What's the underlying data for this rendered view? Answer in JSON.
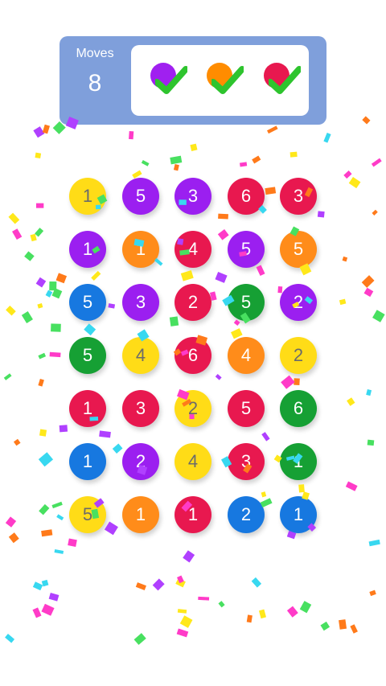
{
  "hud": {
    "moves_label": "Moves",
    "moves_value": "8",
    "goals": [
      {
        "color_name": "purple",
        "color": "#a020f0",
        "icon": "check-icon",
        "completed": true
      },
      {
        "color_name": "orange",
        "color": "#ff8c00",
        "icon": "check-icon",
        "completed": true
      },
      {
        "color_name": "red",
        "color": "#e8184f",
        "icon": "check-icon",
        "completed": true
      }
    ]
  },
  "colors": {
    "yellow": "#ffdc17",
    "purple": "#9b1ff0",
    "red": "#e8184f",
    "orange": "#ff8c1a",
    "blue": "#1778e0",
    "green": "#16a034",
    "hud_bg": "#7f9fdb",
    "check": "#2ec42e"
  },
  "grid": [
    [
      {
        "c": "yellow",
        "n": "1"
      },
      {
        "c": "purple",
        "n": "5"
      },
      {
        "c": "purple",
        "n": "3"
      },
      {
        "c": "red",
        "n": "6"
      },
      {
        "c": "red",
        "n": "3"
      }
    ],
    [
      {
        "c": "purple",
        "n": "1"
      },
      {
        "c": "orange",
        "n": "1"
      },
      {
        "c": "red",
        "n": "4"
      },
      {
        "c": "purple",
        "n": "5"
      },
      {
        "c": "orange",
        "n": "5"
      }
    ],
    [
      {
        "c": "blue",
        "n": "5"
      },
      {
        "c": "purple",
        "n": "3"
      },
      {
        "c": "red",
        "n": "2"
      },
      {
        "c": "green",
        "n": "5"
      },
      {
        "c": "purple",
        "n": "2"
      }
    ],
    [
      {
        "c": "green",
        "n": "5"
      },
      {
        "c": "yellow",
        "n": "4"
      },
      {
        "c": "red",
        "n": "6"
      },
      {
        "c": "orange",
        "n": "4"
      },
      {
        "c": "yellow",
        "n": "2"
      }
    ],
    [
      {
        "c": "red",
        "n": "1"
      },
      {
        "c": "red",
        "n": "3"
      },
      {
        "c": "yellow",
        "n": "2"
      },
      {
        "c": "red",
        "n": "5"
      },
      {
        "c": "green",
        "n": "6"
      }
    ],
    [
      {
        "c": "blue",
        "n": "1"
      },
      {
        "c": "purple",
        "n": "2"
      },
      {
        "c": "yellow",
        "n": "4"
      },
      {
        "c": "red",
        "n": "3"
      },
      {
        "c": "green",
        "n": "1"
      }
    ],
    [
      {
        "c": "yellow",
        "n": "5"
      },
      {
        "c": "orange",
        "n": "1"
      },
      {
        "c": "red",
        "n": "1"
      },
      {
        "c": "blue",
        "n": "2"
      },
      {
        "c": "blue",
        "n": "1"
      }
    ]
  ],
  "confetti_colors": [
    "#ffe81a",
    "#38d8f0",
    "#ff3bc8",
    "#48e060",
    "#ff7a1a",
    "#b040ff"
  ]
}
